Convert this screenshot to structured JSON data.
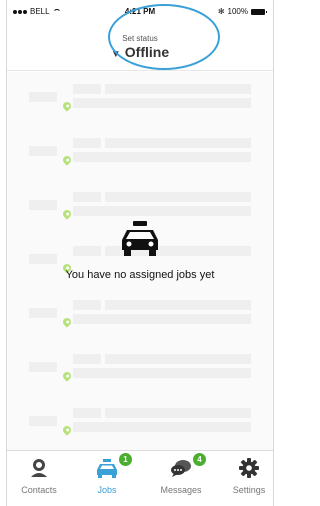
{
  "status_bar": {
    "carrier": "BELL",
    "time": "4:21 PM",
    "battery": "100%",
    "bluetooth": "✻"
  },
  "header": {
    "set_status_label": "Set status",
    "status_value": "Offline",
    "caret": "▼"
  },
  "empty_state": {
    "message": "You have no assigned jobs yet",
    "icon": "taxi-icon"
  },
  "tabs": [
    {
      "label": "Contacts",
      "icon": "contacts-icon",
      "badge": ""
    },
    {
      "label": "Jobs",
      "icon": "jobs-taxi-icon",
      "badge": "1"
    },
    {
      "label": "Messages",
      "icon": "messages-icon",
      "badge": "4"
    },
    {
      "label": "Settings",
      "icon": "gear-icon",
      "badge": ""
    }
  ],
  "colors": {
    "accent": "#3aa0d8",
    "badge": "#4cae2f",
    "pin": "#b6e27b"
  }
}
